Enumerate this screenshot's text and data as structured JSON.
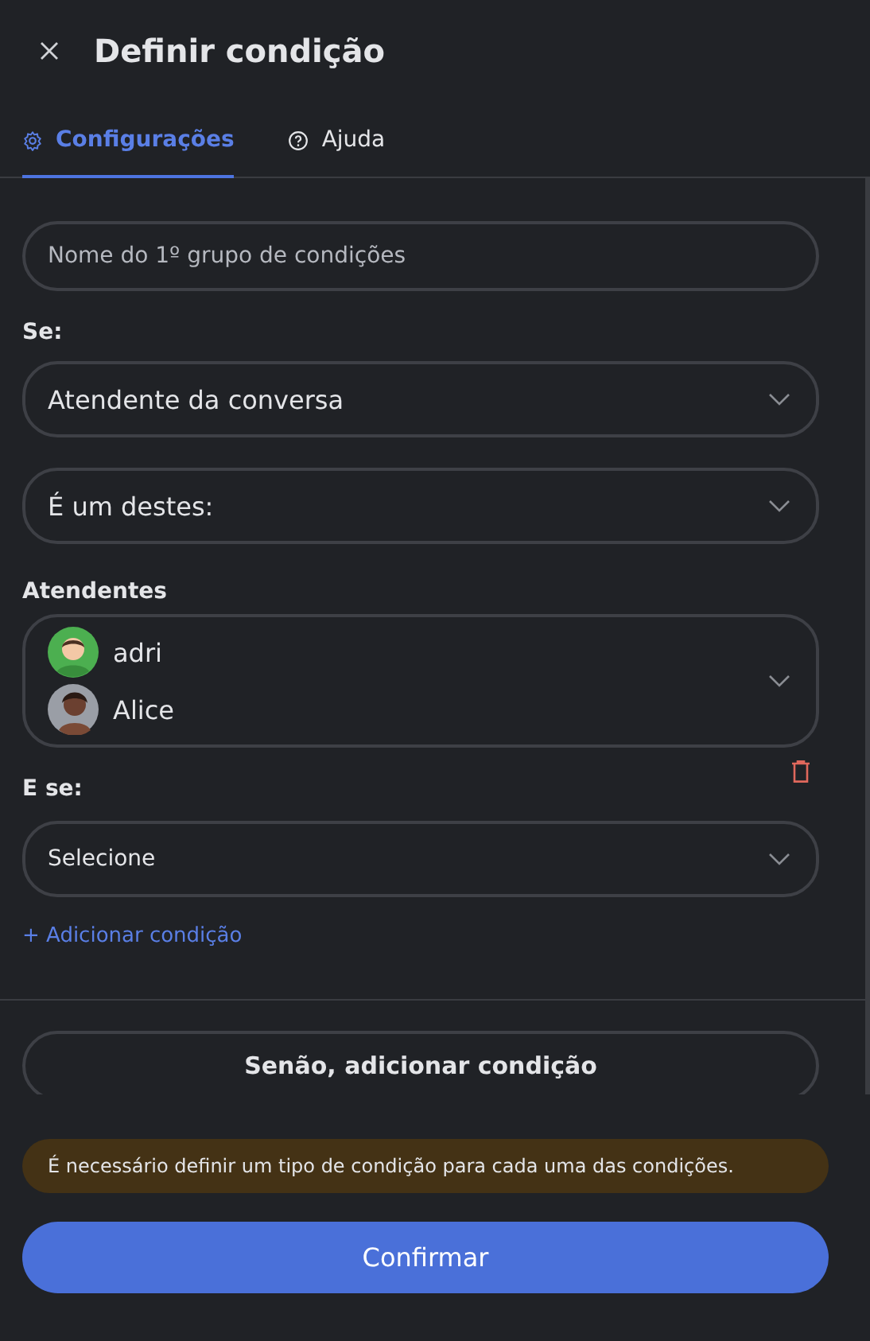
{
  "header": {
    "title": "Definir condição"
  },
  "tabs": [
    {
      "label": "Configurações",
      "kind": "gear",
      "selected": true
    },
    {
      "label": "Ajuda",
      "kind": "help",
      "selected": false
    }
  ],
  "group_name": {
    "placeholder": "Nome do 1º grupo de condições"
  },
  "if_label": "Se:",
  "condition_select": {
    "value": "Atendente da conversa"
  },
  "operator_select": {
    "value": "É um destes:"
  },
  "agents": {
    "label": "Atendentes",
    "items": [
      {
        "name": "adri",
        "kind": "default"
      },
      {
        "name": "Alice",
        "kind": "photo"
      }
    ]
  },
  "and_if": {
    "label": "E se:",
    "select": {
      "value": "Selecione"
    }
  },
  "add_condition": "+ Adicionar condição",
  "else_button": "Senão, adicionar condição",
  "warning": "É necessário definir um tipo de condição para cada uma das condições.",
  "confirm_button": "Confirmar"
}
